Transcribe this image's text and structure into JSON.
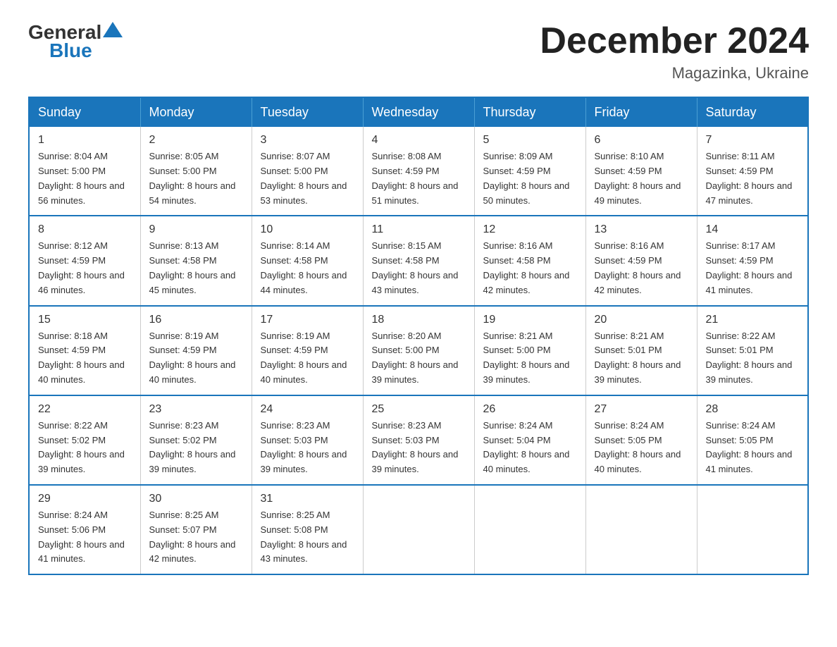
{
  "logo": {
    "text_general": "General",
    "text_blue": "Blue"
  },
  "header": {
    "month_title": "December 2024",
    "location": "Magazinka, Ukraine"
  },
  "days_of_week": [
    "Sunday",
    "Monday",
    "Tuesday",
    "Wednesday",
    "Thursday",
    "Friday",
    "Saturday"
  ],
  "weeks": [
    [
      {
        "day": "1",
        "sunrise": "8:04 AM",
        "sunset": "5:00 PM",
        "daylight": "8 hours and 56 minutes."
      },
      {
        "day": "2",
        "sunrise": "8:05 AM",
        "sunset": "5:00 PM",
        "daylight": "8 hours and 54 minutes."
      },
      {
        "day": "3",
        "sunrise": "8:07 AM",
        "sunset": "5:00 PM",
        "daylight": "8 hours and 53 minutes."
      },
      {
        "day": "4",
        "sunrise": "8:08 AM",
        "sunset": "4:59 PM",
        "daylight": "8 hours and 51 minutes."
      },
      {
        "day": "5",
        "sunrise": "8:09 AM",
        "sunset": "4:59 PM",
        "daylight": "8 hours and 50 minutes."
      },
      {
        "day": "6",
        "sunrise": "8:10 AM",
        "sunset": "4:59 PM",
        "daylight": "8 hours and 49 minutes."
      },
      {
        "day": "7",
        "sunrise": "8:11 AM",
        "sunset": "4:59 PM",
        "daylight": "8 hours and 47 minutes."
      }
    ],
    [
      {
        "day": "8",
        "sunrise": "8:12 AM",
        "sunset": "4:59 PM",
        "daylight": "8 hours and 46 minutes."
      },
      {
        "day": "9",
        "sunrise": "8:13 AM",
        "sunset": "4:58 PM",
        "daylight": "8 hours and 45 minutes."
      },
      {
        "day": "10",
        "sunrise": "8:14 AM",
        "sunset": "4:58 PM",
        "daylight": "8 hours and 44 minutes."
      },
      {
        "day": "11",
        "sunrise": "8:15 AM",
        "sunset": "4:58 PM",
        "daylight": "8 hours and 43 minutes."
      },
      {
        "day": "12",
        "sunrise": "8:16 AM",
        "sunset": "4:58 PM",
        "daylight": "8 hours and 42 minutes."
      },
      {
        "day": "13",
        "sunrise": "8:16 AM",
        "sunset": "4:59 PM",
        "daylight": "8 hours and 42 minutes."
      },
      {
        "day": "14",
        "sunrise": "8:17 AM",
        "sunset": "4:59 PM",
        "daylight": "8 hours and 41 minutes."
      }
    ],
    [
      {
        "day": "15",
        "sunrise": "8:18 AM",
        "sunset": "4:59 PM",
        "daylight": "8 hours and 40 minutes."
      },
      {
        "day": "16",
        "sunrise": "8:19 AM",
        "sunset": "4:59 PM",
        "daylight": "8 hours and 40 minutes."
      },
      {
        "day": "17",
        "sunrise": "8:19 AM",
        "sunset": "4:59 PM",
        "daylight": "8 hours and 40 minutes."
      },
      {
        "day": "18",
        "sunrise": "8:20 AM",
        "sunset": "5:00 PM",
        "daylight": "8 hours and 39 minutes."
      },
      {
        "day": "19",
        "sunrise": "8:21 AM",
        "sunset": "5:00 PM",
        "daylight": "8 hours and 39 minutes."
      },
      {
        "day": "20",
        "sunrise": "8:21 AM",
        "sunset": "5:01 PM",
        "daylight": "8 hours and 39 minutes."
      },
      {
        "day": "21",
        "sunrise": "8:22 AM",
        "sunset": "5:01 PM",
        "daylight": "8 hours and 39 minutes."
      }
    ],
    [
      {
        "day": "22",
        "sunrise": "8:22 AM",
        "sunset": "5:02 PM",
        "daylight": "8 hours and 39 minutes."
      },
      {
        "day": "23",
        "sunrise": "8:23 AM",
        "sunset": "5:02 PM",
        "daylight": "8 hours and 39 minutes."
      },
      {
        "day": "24",
        "sunrise": "8:23 AM",
        "sunset": "5:03 PM",
        "daylight": "8 hours and 39 minutes."
      },
      {
        "day": "25",
        "sunrise": "8:23 AM",
        "sunset": "5:03 PM",
        "daylight": "8 hours and 39 minutes."
      },
      {
        "day": "26",
        "sunrise": "8:24 AM",
        "sunset": "5:04 PM",
        "daylight": "8 hours and 40 minutes."
      },
      {
        "day": "27",
        "sunrise": "8:24 AM",
        "sunset": "5:05 PM",
        "daylight": "8 hours and 40 minutes."
      },
      {
        "day": "28",
        "sunrise": "8:24 AM",
        "sunset": "5:05 PM",
        "daylight": "8 hours and 41 minutes."
      }
    ],
    [
      {
        "day": "29",
        "sunrise": "8:24 AM",
        "sunset": "5:06 PM",
        "daylight": "8 hours and 41 minutes."
      },
      {
        "day": "30",
        "sunrise": "8:25 AM",
        "sunset": "5:07 PM",
        "daylight": "8 hours and 42 minutes."
      },
      {
        "day": "31",
        "sunrise": "8:25 AM",
        "sunset": "5:08 PM",
        "daylight": "8 hours and 43 minutes."
      },
      null,
      null,
      null,
      null
    ]
  ]
}
